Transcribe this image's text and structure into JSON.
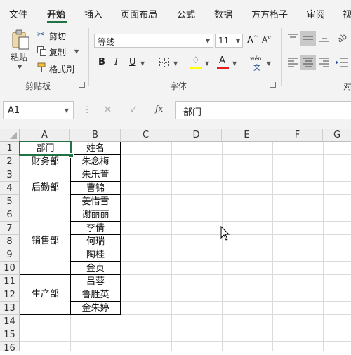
{
  "tabs": [
    "文件",
    "开始",
    "插入",
    "页面布局",
    "公式",
    "数据",
    "方方格子",
    "审阅",
    "视"
  ],
  "active_tab": "开始",
  "clipboard": {
    "paste_label": "粘贴",
    "cut_label": "剪切",
    "copy_label": "复制",
    "format_painter_label": "格式刷",
    "group_label": "剪贴板"
  },
  "font": {
    "font_name": "等线",
    "font_size": "11",
    "grow_label": "A",
    "shrink_label": "A",
    "bold": "B",
    "italic": "I",
    "underline": "U",
    "font_color_label": "A",
    "phonetic_label": "wén",
    "phonetic_char": "文",
    "group_label": "字体"
  },
  "align": {
    "group_label": "对"
  },
  "formula_bar": {
    "name_box": "A1",
    "fx_label": "fx",
    "content": "部门"
  },
  "columns": [
    "A",
    "B",
    "C",
    "D",
    "E",
    "F",
    "G"
  ],
  "rows": [
    "1",
    "2",
    "3",
    "4",
    "5",
    "6",
    "7",
    "8",
    "9",
    "10",
    "11",
    "12",
    "13",
    "14",
    "15",
    "16"
  ],
  "table": {
    "header_a": "部门",
    "header_b": "姓名",
    "departments": [
      "财务部",
      "后勤部",
      "销售部",
      "生产部"
    ],
    "names": [
      "朱念梅",
      "朱乐萱",
      "曹锦",
      "姜惜雪",
      "谢丽丽",
      "李倩",
      "何瑞",
      "陶桂",
      "金贞",
      "吕蓉",
      "鲁胜英",
      "金朱婷"
    ]
  },
  "colors": {
    "accent": "#217346",
    "font_color": "#e02020",
    "highlight": "#ffff00"
  }
}
